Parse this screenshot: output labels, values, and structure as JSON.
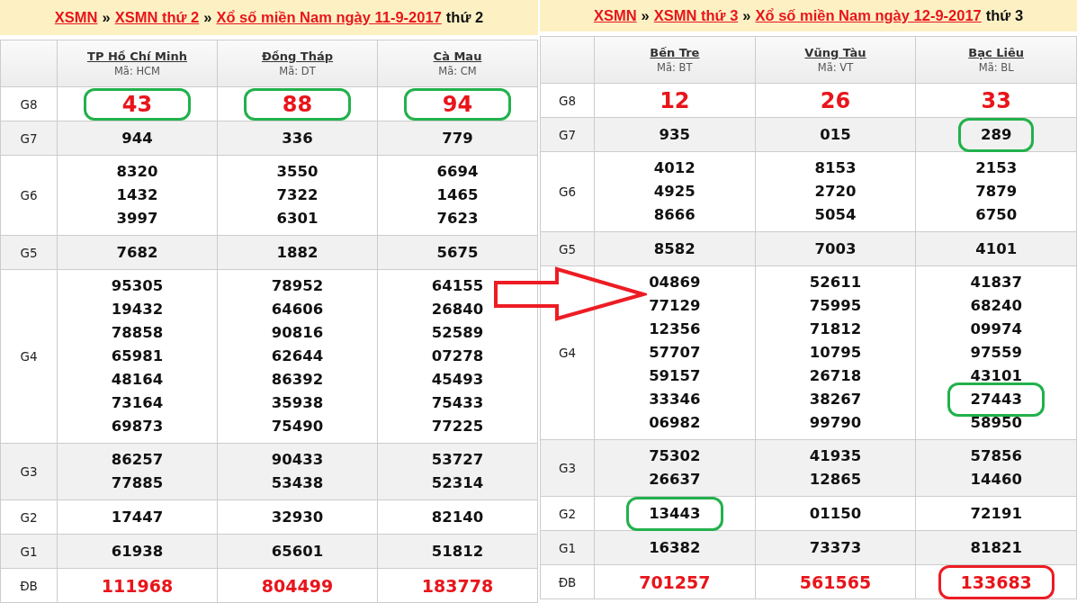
{
  "panels": [
    {
      "breadcrumb": [
        {
          "kind": "link",
          "text": "XSMN"
        },
        {
          "kind": "separator",
          "text": "»"
        },
        {
          "kind": "link",
          "text": "XSMN thứ 2"
        },
        {
          "kind": "separator",
          "text": "»"
        },
        {
          "kind": "link",
          "text": "Xổ số miền Nam ngày 11-9-2017"
        },
        {
          "kind": "plain",
          "text": "thứ 2"
        }
      ],
      "provinces": [
        {
          "name": "TP Hồ Chí Minh",
          "code": "Mã: HCM"
        },
        {
          "name": "Đồng Tháp",
          "code": "Mã: DT"
        },
        {
          "name": "Cà Mau",
          "code": "Mã: CM"
        }
      ],
      "prizes": [
        {
          "label": "G8",
          "kind": "top",
          "cells": [
            [
              {
                "value": "43",
                "color": "#22b14c"
              }
            ],
            [
              {
                "value": "88",
                "color": "#22b14c"
              }
            ],
            [
              {
                "value": "94",
                "color": "#22b14c"
              }
            ]
          ]
        },
        {
          "label": "G7",
          "kind": "normal",
          "cells": [
            [
              {
                "value": "944"
              }
            ],
            [
              {
                "value": "336"
              }
            ],
            [
              {
                "value": "779"
              }
            ]
          ]
        },
        {
          "label": "G6",
          "kind": "normal",
          "cells": [
            [
              {
                "value": "8320"
              },
              {
                "value": "1432"
              },
              {
                "value": "3997"
              }
            ],
            [
              {
                "value": "3550"
              },
              {
                "value": "7322"
              },
              {
                "value": "6301"
              }
            ],
            [
              {
                "value": "6694"
              },
              {
                "value": "1465"
              },
              {
                "value": "7623"
              }
            ]
          ]
        },
        {
          "label": "G5",
          "kind": "normal",
          "cells": [
            [
              {
                "value": "7682"
              }
            ],
            [
              {
                "value": "1882"
              }
            ],
            [
              {
                "value": "5675"
              }
            ]
          ]
        },
        {
          "label": "G4",
          "kind": "normal",
          "cells": [
            [
              {
                "value": "95305"
              },
              {
                "value": "19432"
              },
              {
                "value": "78858"
              },
              {
                "value": "65981"
              },
              {
                "value": "48164"
              },
              {
                "value": "73164"
              },
              {
                "value": "69873"
              }
            ],
            [
              {
                "value": "78952"
              },
              {
                "value": "64606"
              },
              {
                "value": "90816"
              },
              {
                "value": "62644"
              },
              {
                "value": "86392"
              },
              {
                "value": "35938"
              },
              {
                "value": "75490"
              }
            ],
            [
              {
                "value": "64155"
              },
              {
                "value": "26840"
              },
              {
                "value": "52589"
              },
              {
                "value": "07278"
              },
              {
                "value": "45493"
              },
              {
                "value": "75433"
              },
              {
                "value": "77225"
              }
            ]
          ]
        },
        {
          "label": "G3",
          "kind": "normal",
          "cells": [
            [
              {
                "value": "86257"
              },
              {
                "value": "77885"
              }
            ],
            [
              {
                "value": "90433"
              },
              {
                "value": "53438"
              }
            ],
            [
              {
                "value": "53727"
              },
              {
                "value": "52314"
              }
            ]
          ]
        },
        {
          "label": "G2",
          "kind": "normal",
          "cells": [
            [
              {
                "value": "17447"
              }
            ],
            [
              {
                "value": "32930"
              }
            ],
            [
              {
                "value": "82140"
              }
            ]
          ]
        },
        {
          "label": "G1",
          "kind": "normal",
          "cells": [
            [
              {
                "value": "61938"
              }
            ],
            [
              {
                "value": "65601"
              }
            ],
            [
              {
                "value": "51812"
              }
            ]
          ]
        },
        {
          "label": "ĐB",
          "kind": "special",
          "cells": [
            [
              {
                "value": "111968"
              }
            ],
            [
              {
                "value": "804499"
              }
            ],
            [
              {
                "value": "183778"
              }
            ]
          ]
        }
      ]
    },
    {
      "breadcrumb": [
        {
          "kind": "link",
          "text": "XSMN"
        },
        {
          "kind": "separator",
          "text": "»"
        },
        {
          "kind": "link",
          "text": "XSMN thứ 3"
        },
        {
          "kind": "separator",
          "text": "»"
        },
        {
          "kind": "link",
          "text": "Xổ số miền Nam ngày 12-9-2017"
        },
        {
          "kind": "plain",
          "text": "thứ 3"
        }
      ],
      "provinces": [
        {
          "name": "Bến Tre",
          "code": "Mã: BT"
        },
        {
          "name": "Vũng Tàu",
          "code": "Mã: VT"
        },
        {
          "name": "Bạc Liêu",
          "code": "Mã: BL"
        }
      ],
      "prizes": [
        {
          "label": "G8",
          "kind": "top",
          "cells": [
            [
              {
                "value": "12"
              }
            ],
            [
              {
                "value": "26"
              }
            ],
            [
              {
                "value": "33"
              }
            ]
          ]
        },
        {
          "label": "G7",
          "kind": "normal",
          "cells": [
            [
              {
                "value": "935"
              }
            ],
            [
              {
                "value": "015"
              }
            ],
            [
              {
                "value": "289",
                "color": "#22b14c"
              }
            ]
          ]
        },
        {
          "label": "G6",
          "kind": "normal",
          "cells": [
            [
              {
                "value": "4012"
              },
              {
                "value": "4925"
              },
              {
                "value": "8666"
              }
            ],
            [
              {
                "value": "8153"
              },
              {
                "value": "2720"
              },
              {
                "value": "5054"
              }
            ],
            [
              {
                "value": "2153"
              },
              {
                "value": "7879"
              },
              {
                "value": "6750"
              }
            ]
          ]
        },
        {
          "label": "G5",
          "kind": "normal",
          "cells": [
            [
              {
                "value": "8582"
              }
            ],
            [
              {
                "value": "7003"
              }
            ],
            [
              {
                "value": "4101"
              }
            ]
          ]
        },
        {
          "label": "G4",
          "kind": "normal",
          "cells": [
            [
              {
                "value": "04869"
              },
              {
                "value": "77129"
              },
              {
                "value": "12356"
              },
              {
                "value": "57707"
              },
              {
                "value": "59157"
              },
              {
                "value": "33346"
              },
              {
                "value": "06982"
              }
            ],
            [
              {
                "value": "52611"
              },
              {
                "value": "75995"
              },
              {
                "value": "71812"
              },
              {
                "value": "10795"
              },
              {
                "value": "26718"
              },
              {
                "value": "38267"
              },
              {
                "value": "99790"
              }
            ],
            [
              {
                "value": "41837"
              },
              {
                "value": "68240"
              },
              {
                "value": "09974"
              },
              {
                "value": "97559"
              },
              {
                "value": "43101"
              },
              {
                "value": "27443",
                "color": "#22b14c"
              },
              {
                "value": "58950"
              }
            ]
          ]
        },
        {
          "label": "G3",
          "kind": "normal",
          "cells": [
            [
              {
                "value": "75302"
              },
              {
                "value": "26637"
              }
            ],
            [
              {
                "value": "41935"
              },
              {
                "value": "12865"
              }
            ],
            [
              {
                "value": "57856"
              },
              {
                "value": "14460"
              }
            ]
          ]
        },
        {
          "label": "G2",
          "kind": "normal",
          "cells": [
            [
              {
                "value": "13443",
                "color": "#22b14c"
              }
            ],
            [
              {
                "value": "01150"
              }
            ],
            [
              {
                "value": "72191"
              }
            ]
          ]
        },
        {
          "label": "G1",
          "kind": "normal",
          "cells": [
            [
              {
                "value": "16382"
              }
            ],
            [
              {
                "value": "73373"
              }
            ],
            [
              {
                "value": "81821"
              }
            ]
          ]
        },
        {
          "label": "ĐB",
          "kind": "special",
          "cells": [
            [
              {
                "value": "701257"
              }
            ],
            [
              {
                "value": "561565"
              }
            ],
            [
              {
                "value": "133683",
                "color": "#ed1c24"
              }
            ]
          ]
        }
      ]
    }
  ]
}
